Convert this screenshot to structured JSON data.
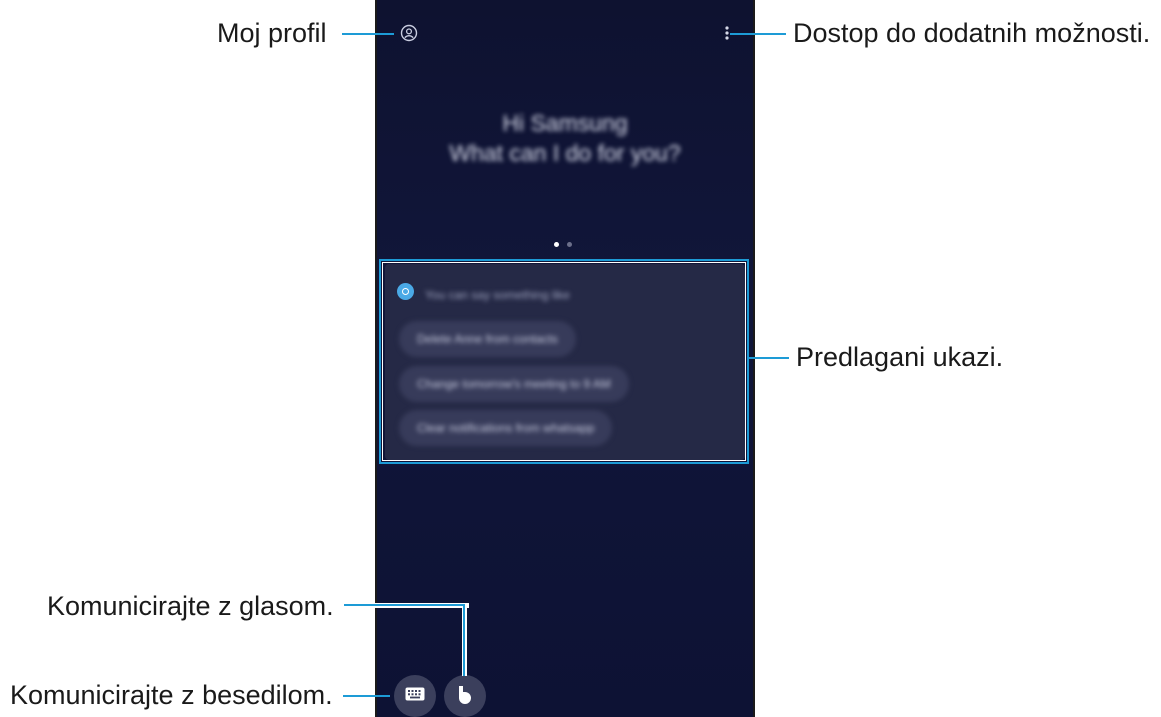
{
  "callouts": {
    "profile": "Moj profil",
    "more_options": "Dostop do dodatnih možnosti.",
    "suggested": "Predlagani ukazi.",
    "voice": "Komunicirajte z glasom.",
    "text": "Komunicirajte z besedilom."
  },
  "screen": {
    "greeting_line1": "Hi Samsung",
    "greeting_line2": "What can I do for you?",
    "suggestions_heading": "You can say something like",
    "suggestions": [
      "Delete Anne from contacts",
      "Change tomorrow's meeting to 9 AM",
      "Clear notifications from whatsapp"
    ]
  },
  "icons": {
    "profile": "profile-icon",
    "more": "more-options-icon",
    "keyboard": "keyboard-icon",
    "voice": "bixby-voice-icon"
  },
  "colors": {
    "accent": "#1d9bd6",
    "screen_bg": "#0f1333",
    "card_bg": "#252946"
  },
  "page_indicator": {
    "pages": 2,
    "active": 1
  }
}
